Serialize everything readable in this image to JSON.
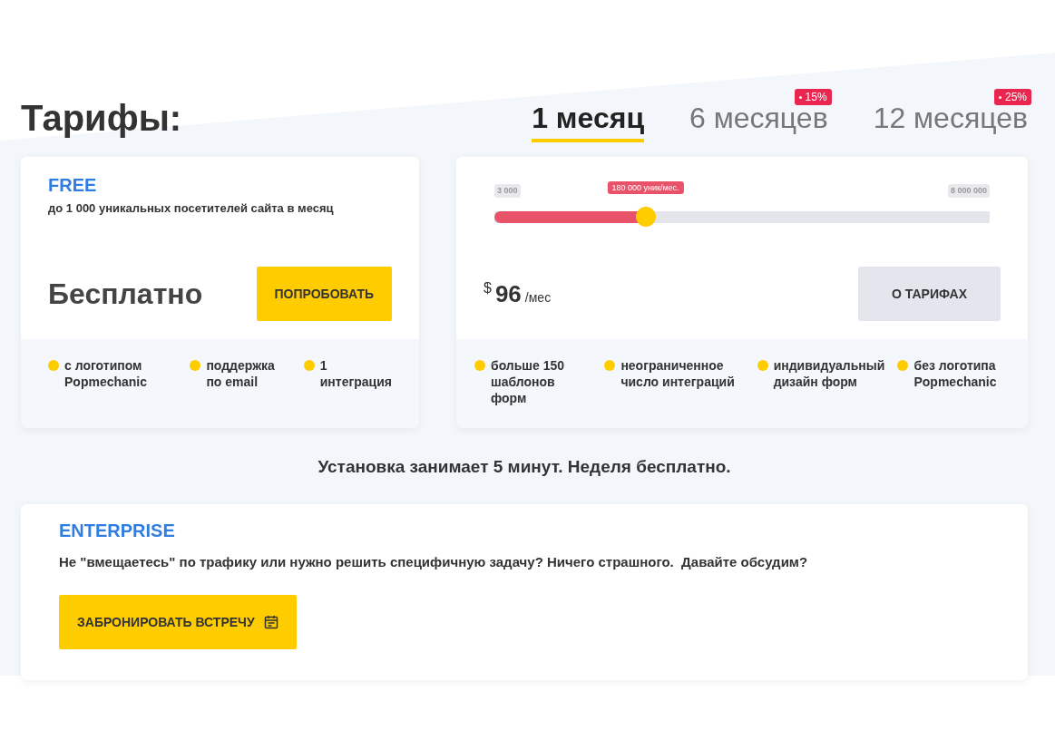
{
  "title": "Тарифы:",
  "tabs": [
    {
      "label": "1 месяц",
      "selected": true
    },
    {
      "label": "6 месяцев",
      "selected": false,
      "badge": "15%"
    },
    {
      "label": "12 месяцев",
      "selected": false,
      "badge": "25%"
    }
  ],
  "free_plan": {
    "name": "FREE",
    "description": "до 1 000 уникальных посетителей сайта в месяц",
    "price": "Бесплатно",
    "button": "ПОПРОБОВАТЬ",
    "features": [
      "с логотипом Popmechanic",
      "поддержка по email",
      "1 интеграция"
    ]
  },
  "paid_plan": {
    "slider": {
      "min": "3 000",
      "max": "8 000 000",
      "value": "180 000 уник/мес.",
      "level": 0.305
    },
    "currency": "$",
    "price": "96",
    "period": "/мес",
    "button": "О ТАРИФАХ",
    "features": [
      "больше 150 шаблонов форм",
      "неограниченное число интеграций",
      "индивидуальный дизайн форм",
      "без логотипа Popmechanic"
    ]
  },
  "note": "Установка занимает 5 минут. Неделя бесплатно.",
  "enterprise": {
    "name": "ENTERPRISE",
    "text": "Не \"вмещаетесь\" по трафику или нужно решить специфичную задачу? Ничего страшного.  Давайте обсудим?",
    "button": "ЗАБРОНИРОВАТЬ ВСТРЕЧУ"
  }
}
